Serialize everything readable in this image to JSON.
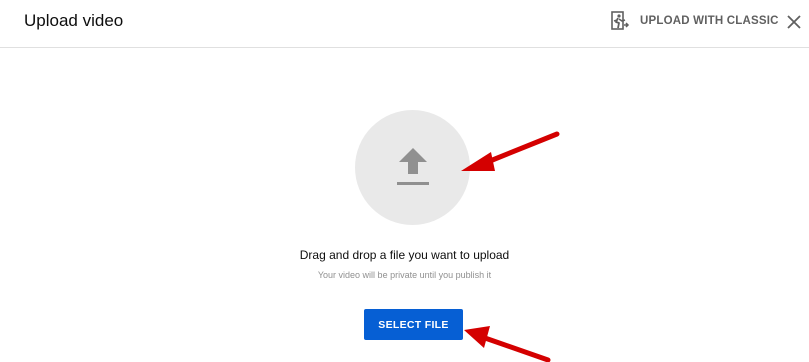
{
  "dialog": {
    "title": "Upload video",
    "classic_label": "UPLOAD WITH CLASSIC",
    "classic_icon": "exit-classic-icon",
    "close_icon": "close-icon"
  },
  "dropzone": {
    "icon": "upload-arrow-icon",
    "primary_text": "Drag and drop a file you want to upload",
    "secondary_text": "Your video will be private until you publish it"
  },
  "select_button": {
    "label": "SELECT FILE"
  },
  "annotations": {
    "arrow_color": "#e00000",
    "count": 2
  },
  "colors": {
    "accent": "#065fd4",
    "circle_bg": "#e9e9e9",
    "icon_gray": "#909090"
  }
}
